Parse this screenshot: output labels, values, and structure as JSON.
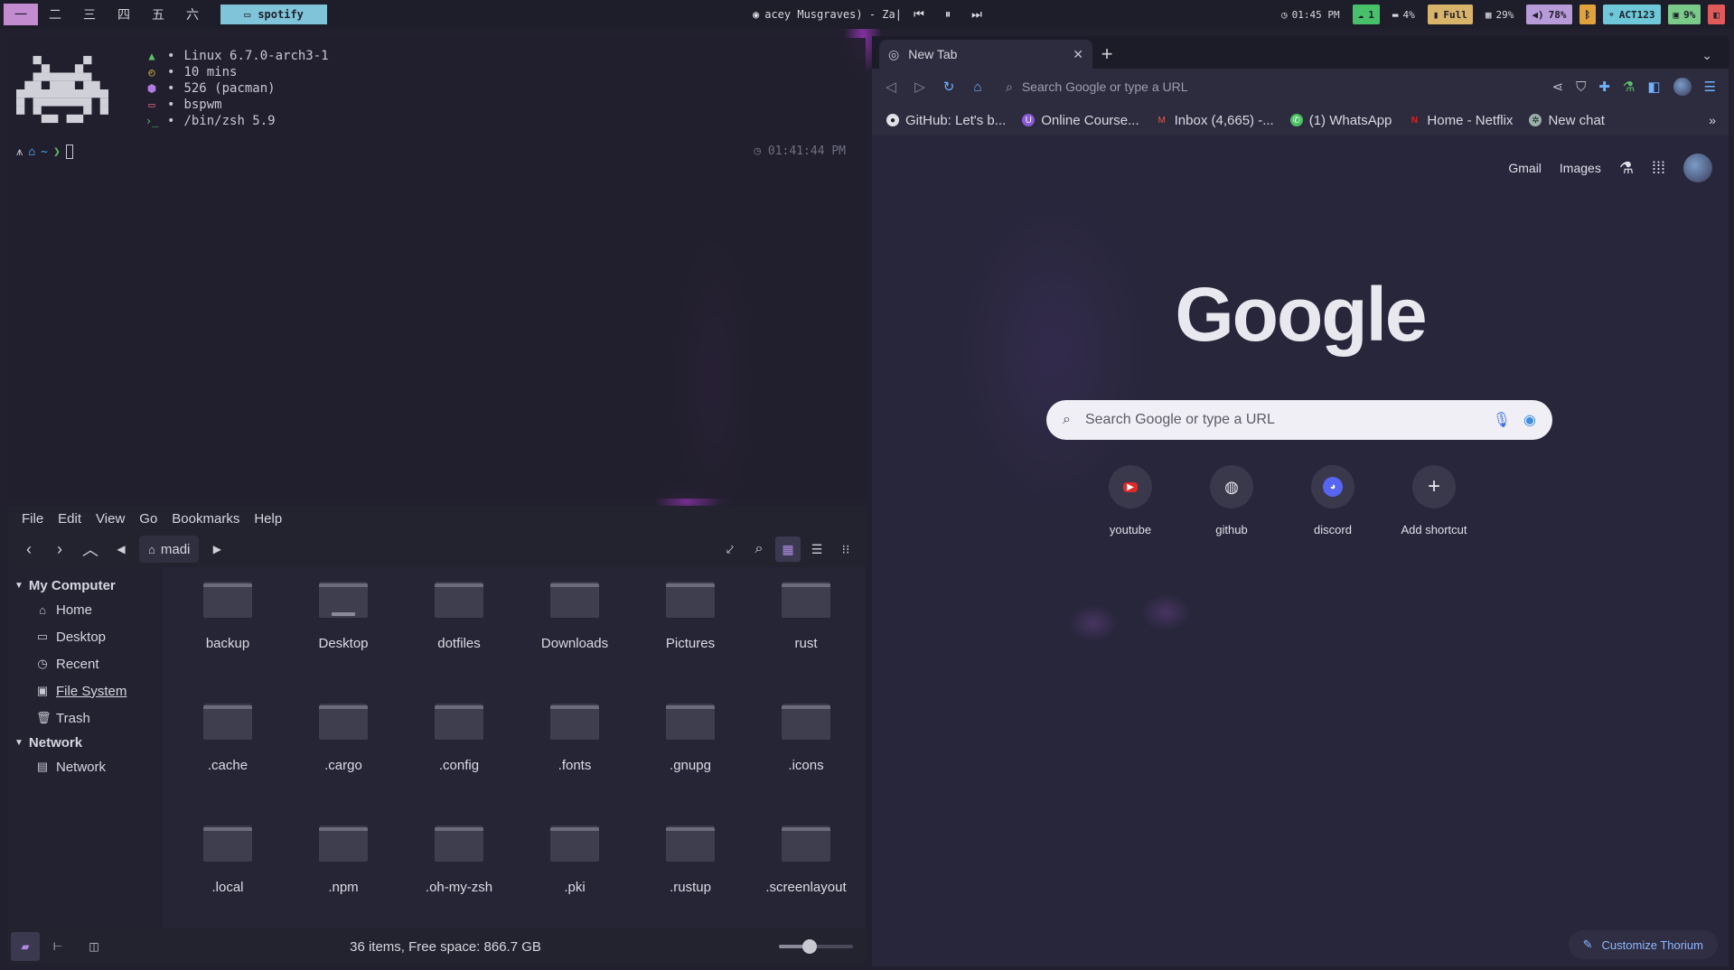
{
  "topbar": {
    "workspaces": [
      "一",
      "二",
      "三",
      "四",
      "五",
      "六"
    ],
    "window_tag": "spotify",
    "now_playing": "acey Musgraves) - Za|",
    "clock": "01:45 PM",
    "updates": "1",
    "disk": "4%",
    "battery": "Full",
    "memory": "29%",
    "volume": "78%",
    "wifi": "ACT123",
    "cpu": "9%"
  },
  "terminal": {
    "os": "Linux 6.7.0-arch3-1",
    "uptime": "10 mins",
    "packages": "526 (pacman)",
    "wm": "bspwm",
    "shell": "/bin/zsh 5.9",
    "prompt_dir": "~",
    "time": "01:41:44 PM"
  },
  "filemanager": {
    "menu": [
      "File",
      "Edit",
      "View",
      "Go",
      "Bookmarks",
      "Help"
    ],
    "location": "madi",
    "sidebar": {
      "computer_header": "My Computer",
      "computer_items": [
        "Home",
        "Desktop",
        "Recent",
        "File System",
        "Trash"
      ],
      "network_header": "Network",
      "network_items": [
        "Network"
      ]
    },
    "items": [
      "backup",
      "Desktop",
      "dotfiles",
      "Downloads",
      "Pictures",
      "rust",
      ".cache",
      ".cargo",
      ".config",
      ".fonts",
      ".gnupg",
      ".icons",
      ".local",
      ".npm",
      ".oh-my-zsh",
      ".pki",
      ".rustup",
      ".screenlayout"
    ],
    "status": "36 items, Free space: 866.7 GB",
    "zoom_level": 0.42
  },
  "browser": {
    "tab_title": "New Tab",
    "omnibox_placeholder": "Search Google or type a URL",
    "bookmarks": [
      "GitHub: Let's b...",
      "Online Course...",
      "Inbox (4,665) -...",
      "(1) WhatsApp",
      "Home - Netflix",
      "New chat"
    ],
    "ntp": {
      "gmail": "Gmail",
      "images": "Images",
      "logo": "Google",
      "search_placeholder": "Search Google or type a URL",
      "shortcuts": [
        "youtube",
        "github",
        "discord",
        "Add shortcut"
      ],
      "customize": "Customize Thorium"
    }
  },
  "colors": {
    "active_workspace": "#c38bd0",
    "spotify_tag": "#7fc4d9",
    "accent_blue": "#6fb0ff"
  }
}
